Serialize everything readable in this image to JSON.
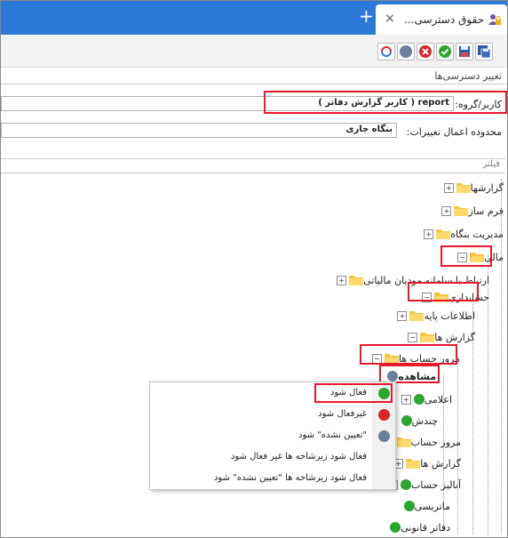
{
  "window": {
    "tab_title": "حقوق دسترسی...",
    "close_glyph": "×",
    "new_tab_glyph": "+"
  },
  "toolbar": {
    "buttons": [
      "remove-access",
      "clear",
      "deny",
      "allow",
      "save",
      "save-as"
    ]
  },
  "section_title": "تغییر دسترسی‌ها",
  "form": {
    "user_group_label": "کاربر/گروه:",
    "user_group_value": "report ( کاربر گزارش دفاتر )",
    "scope_label": "محدوده اعمال تغییرات:",
    "scope_value": "بنگاه جاری"
  },
  "filter": {
    "placeholder": "فیلتر"
  },
  "tree": {
    "reports": "گزارشها",
    "form_builder": "فرم ساز",
    "company_mgmt": "مدیریت بنگاه",
    "finance": "مالی",
    "tax_system": "ارتباط با سامانه مودیان مالیاتی",
    "accounting": "حسابداری",
    "base_info": "اطلاعات پایه",
    "acc_reports": "گزارش ها",
    "account_review": "مرور حساب ها",
    "view": "مشاهده",
    "announce": "اعلامی",
    "multi": "چندش",
    "account_review2": "مرور حساب",
    "reports2": "گزارش ها",
    "analysis": "آنالیز حساب",
    "matrix": "ماتریسی",
    "legal_books": "دفاتر قانونی"
  },
  "context_menu": {
    "items": [
      {
        "label": "فعال شود",
        "icon": "green-check-icon"
      },
      {
        "label": "غیرفعال شود",
        "icon": "red-x-icon"
      },
      {
        "label": "\"تعیین نشده\" شود",
        "icon": "grey-dot-icon"
      },
      {
        "label": "فعال شود زیرشاخه ها غیر فعال شود",
        "icon": ""
      },
      {
        "label": "فعال شود زیرشاخه ها \"تعیین نشده\" شود",
        "icon": ""
      }
    ]
  },
  "colors": {
    "titlebar": "#2b79d8",
    "highlight": "#e8192c",
    "allowed": "#2aa72e",
    "denied": "#d9262a",
    "undetermined": "#6b7f9c"
  }
}
